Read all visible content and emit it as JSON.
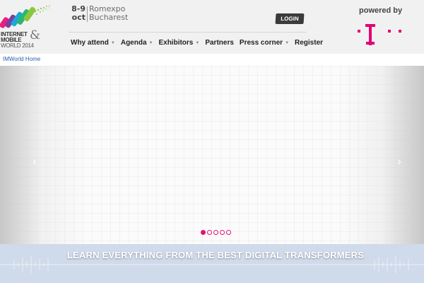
{
  "header": {
    "logo": {
      "line1": "INTERNET",
      "line2": "MOBILE",
      "line3": "WORLD 2014",
      "amp": "&"
    },
    "event": {
      "dates_top": "8-9",
      "dates_bottom": "oct",
      "venue_top": "Romexpo",
      "venue_bottom": "Bucharest"
    },
    "login_label": "LOGIN",
    "powered_by": "powered by",
    "sponsor_logo_icon": "telekom-t-logo",
    "brand_color": "#e20074"
  },
  "nav": {
    "items": [
      {
        "label": "Why attend",
        "dropdown": true
      },
      {
        "label": "Agenda",
        "dropdown": true
      },
      {
        "label": "Exhibitors",
        "dropdown": true
      },
      {
        "label": "Partners",
        "dropdown": false
      },
      {
        "label": "Press corner",
        "dropdown": true
      },
      {
        "label": "Register",
        "dropdown": false
      }
    ]
  },
  "breadcrumb": {
    "home": "IMWorld Home"
  },
  "slider": {
    "prev_icon": "chevron-left-icon",
    "next_icon": "chevron-right-icon",
    "prev_glyph": "‹",
    "next_glyph": "›",
    "slide_count": 5,
    "active_index": 0,
    "banner_text": "LEARN EVERYTHING FROM THE BEST DIGITAL TRANSFORMERS"
  }
}
